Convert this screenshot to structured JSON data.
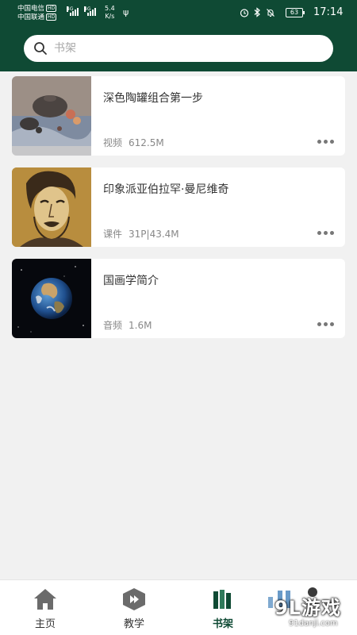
{
  "status_bar": {
    "carrier1": "中国电信",
    "carrier2": "中国联通",
    "hd": "HD",
    "net1": "4G",
    "net2": "4G",
    "speed_value": "5.4",
    "speed_unit": "K/s",
    "battery": "63",
    "time": "17:14"
  },
  "search": {
    "placeholder": "书架",
    "value": ""
  },
  "items": [
    {
      "title": "深色陶罐组合第一步",
      "type": "视频",
      "size": "612.5M",
      "thumb": "still-life-painting"
    },
    {
      "title": "印象派亚伯拉罕·曼尼维奇",
      "type": "课件",
      "size": "31P|43.4M",
      "thumb": "portrait-drawing"
    },
    {
      "title": "国画学简介",
      "type": "音频",
      "size": "1.6M",
      "thumb": "earth-image"
    }
  ],
  "tabs": [
    {
      "label": "主页",
      "icon": "home-icon"
    },
    {
      "label": "教学",
      "icon": "teach-icon"
    },
    {
      "label": "书架",
      "icon": "bookshelf-icon",
      "active": true
    }
  ],
  "watermark": {
    "text": "9L游戏",
    "url": "91danji.com"
  },
  "colors": {
    "primary": "#0f4a34",
    "background": "#f1f1f1"
  }
}
